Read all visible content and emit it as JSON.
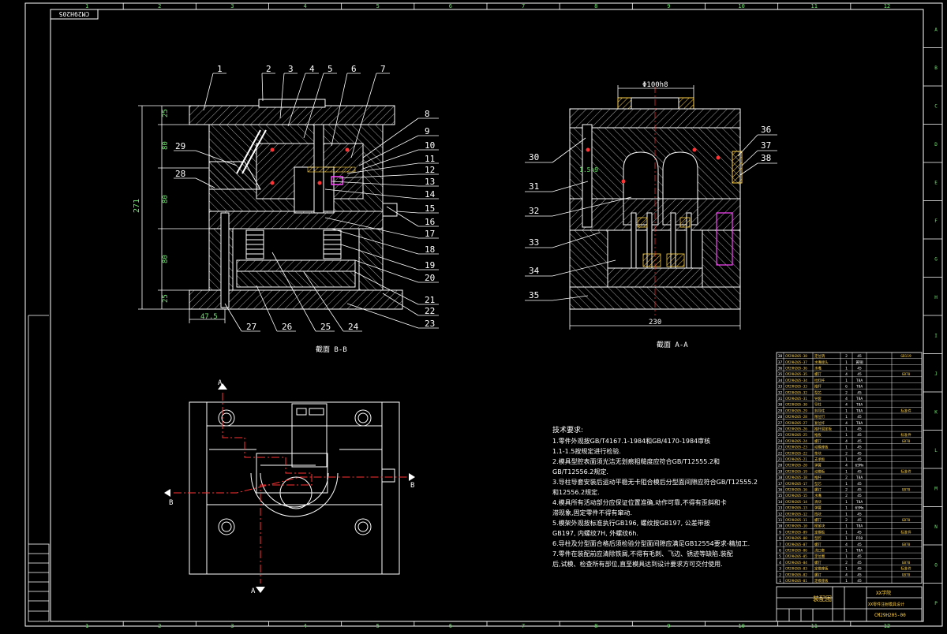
{
  "drawing": {
    "code": "CM29H205",
    "colors": {
      "background": "#000000",
      "frame": "#ffffff",
      "outline": "#ffffff",
      "hatch": "#d9d9d9",
      "leader": "#ffffff",
      "center_line": "#ff3333",
      "green_dim": "#6fe36f",
      "magenta": "#ff44ff",
      "yellow": "#ffd24a",
      "cyan": "#44e8ff"
    },
    "column_labels": [
      "1",
      "2",
      "3",
      "4",
      "5",
      "6",
      "7",
      "8",
      "9",
      "10",
      "11",
      "12"
    ],
    "row_labels": [
      "A",
      "B",
      "C",
      "D",
      "E",
      "F",
      "G",
      "H",
      "I",
      "J",
      "K",
      "L",
      "M",
      "N",
      "O",
      "P"
    ]
  },
  "section_bb": {
    "label": "截面 B-B",
    "part_numbers_top": [
      "1",
      "2",
      "3",
      "4",
      "5",
      "6",
      "7"
    ],
    "part_numbers_right": [
      "8",
      "9",
      "10",
      "11",
      "12",
      "13",
      "14",
      "15",
      "16",
      "17",
      "18",
      "19",
      "20",
      "21",
      "22",
      "23"
    ],
    "part_numbers_bottom": [
      "27",
      "26",
      "25",
      "24"
    ],
    "part_numbers_left": [
      "29",
      "28"
    ],
    "dims_vertical": [
      "25",
      "80",
      "80",
      "80",
      "25"
    ],
    "dim_total": "271",
    "dim_bottom": "47.5"
  },
  "section_aa": {
    "label": "截面 A-A",
    "dim_top": "Φ100h8",
    "dim_bottom": "230",
    "dim_inner": "1.5h9",
    "part_numbers_left": [
      "30",
      "31",
      "32",
      "33",
      "34",
      "35"
    ],
    "part_numbers_right": [
      "36",
      "37",
      "38"
    ]
  },
  "plan_view": {
    "section_marks": [
      "A",
      "A",
      "B",
      "B"
    ]
  },
  "notes": {
    "title": "技术要求:",
    "lines": [
      "1.零件外观按GB/T4167.1-1984和GB/4170-1984审核",
      "1.1-1.5按规定进行检验.",
      "2.模具型腔表面须光洁无划痕粗糙度应符合GB/T12555.2和",
      "GB/T12556.2规定.",
      "3.导柱导套安装后运动平稳无卡阻合模后分型面间隙应符合GB/T12555.2",
      "和12556.2规定.",
      "4.模具所有活动部分应保证位置准确,动作可靠,不得有歪斜和卡",
      "滞现象,固定零件不得有窜动.",
      "5.模架外观按标准执行GB196, 螺纹按GB197, 公差带按",
      "GB197, 内螺纹7H, 外螺纹6h.",
      "6.导柱及分型面合格后须检验分型面间隙应满足GB12554要求-精加工.",
      "7.零件在装配前应清除铁屑,不得有毛刺、飞边、锈迹等缺陷.装配",
      "后,试模、检查所有部位,直至模具达到设计要求方可交付使用."
    ]
  },
  "bom": {
    "rows": [
      {
        "no": "38",
        "code": "CM29H205-38",
        "name": "定位销",
        "qty": "2",
        "mat": "45",
        "note": "GB119"
      },
      {
        "no": "37",
        "code": "CM29H205-37",
        "name": "水嘴接头",
        "qty": "1",
        "mat": "黄铜",
        "note": ""
      },
      {
        "no": "36",
        "code": "CM29H205-36",
        "name": "水嘴",
        "qty": "1",
        "mat": "45",
        "note": ""
      },
      {
        "no": "35",
        "code": "CM29H205-35",
        "name": "螺钉",
        "qty": "4",
        "mat": "45",
        "note": "GB70"
      },
      {
        "no": "34",
        "code": "CM29H205-34",
        "name": "拉料杆",
        "qty": "1",
        "mat": "T8A",
        "note": ""
      },
      {
        "no": "33",
        "code": "CM29H205-33",
        "name": "推杆",
        "qty": "6",
        "mat": "T8A",
        "note": ""
      },
      {
        "no": "32",
        "code": "CM29H205-32",
        "name": "型芯",
        "qty": "2",
        "mat": "45",
        "note": ""
      },
      {
        "no": "31",
        "code": "CM29H205-31",
        "name": "导套",
        "qty": "4",
        "mat": "T8A",
        "note": ""
      },
      {
        "no": "30",
        "code": "CM29H205-30",
        "name": "导柱",
        "qty": "4",
        "mat": "T8A",
        "note": ""
      },
      {
        "no": "29",
        "code": "CM29H205-29",
        "name": "斜导柱",
        "qty": "1",
        "mat": "T8A",
        "note": "标准件"
      },
      {
        "no": "28",
        "code": "CM29H205-28",
        "name": "限位钉",
        "qty": "1",
        "mat": "45",
        "note": ""
      },
      {
        "no": "27",
        "code": "CM29H205-27",
        "name": "复位杆",
        "qty": "4",
        "mat": "T8A",
        "note": ""
      },
      {
        "no": "26",
        "code": "CM29H205-26",
        "name": "推杆固定板",
        "qty": "1",
        "mat": "45",
        "note": ""
      },
      {
        "no": "25",
        "code": "CM29H205-25",
        "name": "推板",
        "qty": "1",
        "mat": "45",
        "note": "标准件"
      },
      {
        "no": "24",
        "code": "CM29H205-24",
        "name": "螺钉",
        "qty": "4",
        "mat": "45",
        "note": "GB70"
      },
      {
        "no": "23",
        "code": "CM29H205-23",
        "name": "动模座板",
        "qty": "1",
        "mat": "45",
        "note": ""
      },
      {
        "no": "22",
        "code": "CM29H205-22",
        "name": "垫块",
        "qty": "2",
        "mat": "45",
        "note": ""
      },
      {
        "no": "21",
        "code": "CM29H205-21",
        "name": "支承板",
        "qty": "1",
        "mat": "45",
        "note": ""
      },
      {
        "no": "20",
        "code": "CM29H205-20",
        "name": "弹簧",
        "qty": "4",
        "mat": "65Mn",
        "note": ""
      },
      {
        "no": "19",
        "code": "CM29H205-19",
        "name": "动模板",
        "qty": "1",
        "mat": "45",
        "note": "标准件"
      },
      {
        "no": "18",
        "code": "CM29H205-18",
        "name": "推杆",
        "qty": "2",
        "mat": "T8A",
        "note": ""
      },
      {
        "no": "17",
        "code": "CM29H205-17",
        "name": "型芯",
        "qty": "1",
        "mat": "45",
        "note": ""
      },
      {
        "no": "16",
        "code": "CM29H205-16",
        "name": "螺钉",
        "qty": "2",
        "mat": "45",
        "note": "GB70"
      },
      {
        "no": "15",
        "code": "CM29H205-15",
        "name": "水嘴",
        "qty": "2",
        "mat": "45",
        "note": ""
      },
      {
        "no": "14",
        "code": "CM29H205-14",
        "name": "滑块",
        "qty": "1",
        "mat": "T8A",
        "note": ""
      },
      {
        "no": "13",
        "code": "CM29H205-13",
        "name": "弹簧",
        "qty": "1",
        "mat": "65Mn",
        "note": ""
      },
      {
        "no": "12",
        "code": "CM29H205-12",
        "name": "挡块",
        "qty": "1",
        "mat": "45",
        "note": ""
      },
      {
        "no": "11",
        "code": "CM29H205-11",
        "name": "螺钉",
        "qty": "2",
        "mat": "45",
        "note": "GB70"
      },
      {
        "no": "10",
        "code": "CM29H205-10",
        "name": "楔紧块",
        "qty": "1",
        "mat": "T8A",
        "note": ""
      },
      {
        "no": "9",
        "code": "CM29H205-09",
        "name": "定模板",
        "qty": "1",
        "mat": "45",
        "note": "标准件"
      },
      {
        "no": "8",
        "code": "CM29H205-08",
        "name": "型腔",
        "qty": "1",
        "mat": "P20",
        "note": ""
      },
      {
        "no": "7",
        "code": "CM29H205-07",
        "name": "螺钉",
        "qty": "4",
        "mat": "45",
        "note": "GB70"
      },
      {
        "no": "6",
        "code": "CM29H205-06",
        "name": "浇口套",
        "qty": "1",
        "mat": "T8A",
        "note": ""
      },
      {
        "no": "5",
        "code": "CM29H205-05",
        "name": "定位圈",
        "qty": "1",
        "mat": "45",
        "note": ""
      },
      {
        "no": "4",
        "code": "CM29H205-04",
        "name": "螺钉",
        "qty": "2",
        "mat": "45",
        "note": "GB70"
      },
      {
        "no": "3",
        "code": "CM29H205-03",
        "name": "定模座板",
        "qty": "1",
        "mat": "45",
        "note": "标准件"
      },
      {
        "no": "2",
        "code": "CM29H205-02",
        "name": "螺钉",
        "qty": "4",
        "mat": "45",
        "note": "GB70"
      },
      {
        "no": "1",
        "code": "CM29H205-01",
        "name": "定模座板",
        "qty": "1",
        "mat": "45",
        "note": ""
      }
    ]
  },
  "title_block": {
    "title": "装配图",
    "company": "XX学院",
    "part_name": "XX零件注射模具设计",
    "code": "CM29H205-00"
  }
}
